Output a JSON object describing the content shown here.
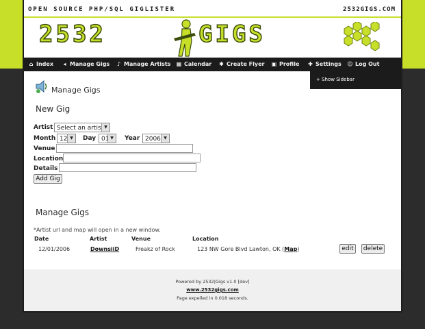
{
  "header": {
    "tagline": "OPEN SOURCE PHP/SQL GIGLISTER",
    "site": "2532GIGS.COM",
    "logo_left": "2532",
    "logo_right": "GIGS"
  },
  "nav": {
    "items": [
      {
        "label": "Index",
        "icon": "home-icon"
      },
      {
        "label": "Manage Gigs",
        "icon": "speaker-icon"
      },
      {
        "label": "Manage Artists",
        "icon": "music-note-icon"
      },
      {
        "label": "Calendar",
        "icon": "calendar-icon"
      },
      {
        "label": "Create Flyer",
        "icon": "flyer-icon"
      },
      {
        "label": "Profile",
        "icon": "profile-icon"
      },
      {
        "label": "Settings",
        "icon": "settings-icon"
      },
      {
        "label": "Log Out",
        "icon": "logout-icon"
      }
    ],
    "dropdown_item": "+ Show Sidebar"
  },
  "page_title": "Manage Gigs",
  "new_gig": {
    "title": "New Gig",
    "artist_label": "Artist",
    "artist_value": "Select an artist",
    "month_label": "Month",
    "month_value": "12",
    "day_label": "Day",
    "day_value": "01",
    "year_label": "Year",
    "year_value": "2006",
    "venue_label": "Venue",
    "location_label": "Location",
    "details_label": "Details",
    "add_button": "Add Gig"
  },
  "manage": {
    "title": "Manage Gigs",
    "note": "*Artist url and map will open in a new window.",
    "columns": [
      "Date",
      "Artist",
      "Venue",
      "Location"
    ],
    "rows": [
      {
        "date": "12/01/2006",
        "artist": "DownsiiD",
        "venue": "Freakz of Rock",
        "location_prefix": "123 NW Gore Blvd Lawton, OK (",
        "map": "Map",
        "location_suffix": ")",
        "edit": "edit",
        "delete": "delete"
      }
    ]
  },
  "footer": {
    "powered": "Powered by 2532|Gigs v1.0 [dev]",
    "link": "www.2532gigs.com",
    "timing": "Page expelled in 0.018 seconds."
  },
  "colors": {
    "accent": "#c8df2a",
    "nav_bg": "#1b1b1b",
    "body_dark": "#2c2c2c"
  }
}
